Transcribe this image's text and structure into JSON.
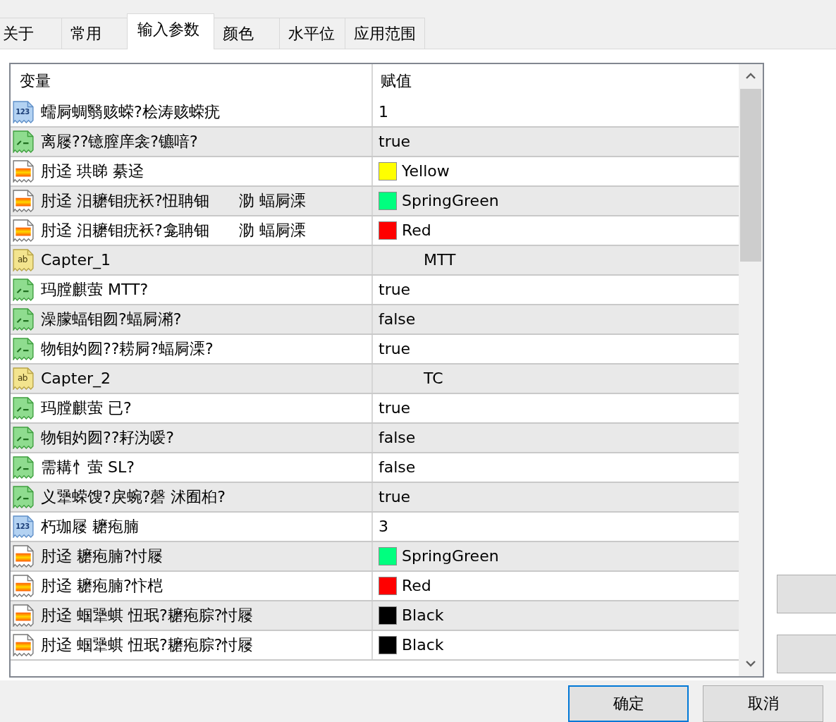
{
  "tabs": [
    {
      "label": "关于",
      "selected": false
    },
    {
      "label": "常用",
      "selected": false
    },
    {
      "label": "输入参数",
      "selected": true
    },
    {
      "label": "颜色",
      "selected": false
    },
    {
      "label": "水平位",
      "selected": false
    },
    {
      "label": "应用范围",
      "selected": false
    }
  ],
  "table": {
    "columns": [
      "变量",
      "赋值"
    ],
    "rows": [
      {
        "kind": "int",
        "icon_label": "123",
        "name": "蠕屙蜩翳赅蝾?桧涛赅蝾疣",
        "value": "1"
      },
      {
        "kind": "bool",
        "name": "离屦??镱膣庠衾?镳喑?",
        "value": "true"
      },
      {
        "kind": "color",
        "name": "肘迳 珙睇 綦迳",
        "value": "Yellow",
        "color": "#ffff00"
      },
      {
        "kind": "color",
        "name": "肘迳 汨耱钼疣袄?忸聃钿      泐 蝠屙溧",
        "value": "SpringGreen",
        "color": "#00ff7f"
      },
      {
        "kind": "color",
        "name": "肘迳 汨耱钼疣袄?龛聃钿      泐 蝠屙溧",
        "value": "Red",
        "color": "#ff0000"
      },
      {
        "kind": "string",
        "icon_label": "ab",
        "name": "Capter_1",
        "value": "MTT"
      },
      {
        "kind": "bool",
        "name": "玛膛麒萤 MTT?",
        "value": "true"
      },
      {
        "kind": "bool",
        "name": "澡朦蝠钼囫?蝠屙潲?",
        "value": "false"
      },
      {
        "kind": "bool",
        "name": "物钼妁囫??耢屙?蝠屙溧?",
        "value": "true"
      },
      {
        "kind": "string",
        "icon_label": "ab",
        "name": "Capter_2",
        "value": "TC"
      },
      {
        "kind": "bool",
        "name": "玛膛麒萤 已?",
        "value": "true"
      },
      {
        "kind": "bool",
        "name": "物钼妁囫??耔沩嗳?",
        "value": "false"
      },
      {
        "kind": "bool",
        "name": "需耩忄萤 SL?",
        "value": "false"
      },
      {
        "kind": "bool",
        "name": "义犟蝾馊?戾蜿?磬 沭囿桕?",
        "value": "true"
      },
      {
        "kind": "int",
        "icon_label": "123",
        "name": "朽珈屦 耱疱腩",
        "value": "3"
      },
      {
        "kind": "color",
        "name": "肘迳 耱疱腩?忖屦",
        "value": "SpringGreen",
        "color": "#00ff7f"
      },
      {
        "kind": "color",
        "name": "肘迳 耱疱腩?忭桤",
        "value": "Red",
        "color": "#ff0000"
      },
      {
        "kind": "color",
        "name": "肘迳 蝈犟蜞 忸珉?耱疱腙?忖屦",
        "value": "Black",
        "color": "#000000"
      },
      {
        "kind": "color",
        "name": "肘迳 蝈犟蜞 忸珉?耱疱腙?忖屦",
        "value": "Black",
        "color": "#000000"
      }
    ]
  },
  "buttons": [
    {
      "label": "确定",
      "default": true
    },
    {
      "label": "取消",
      "default": false
    }
  ]
}
